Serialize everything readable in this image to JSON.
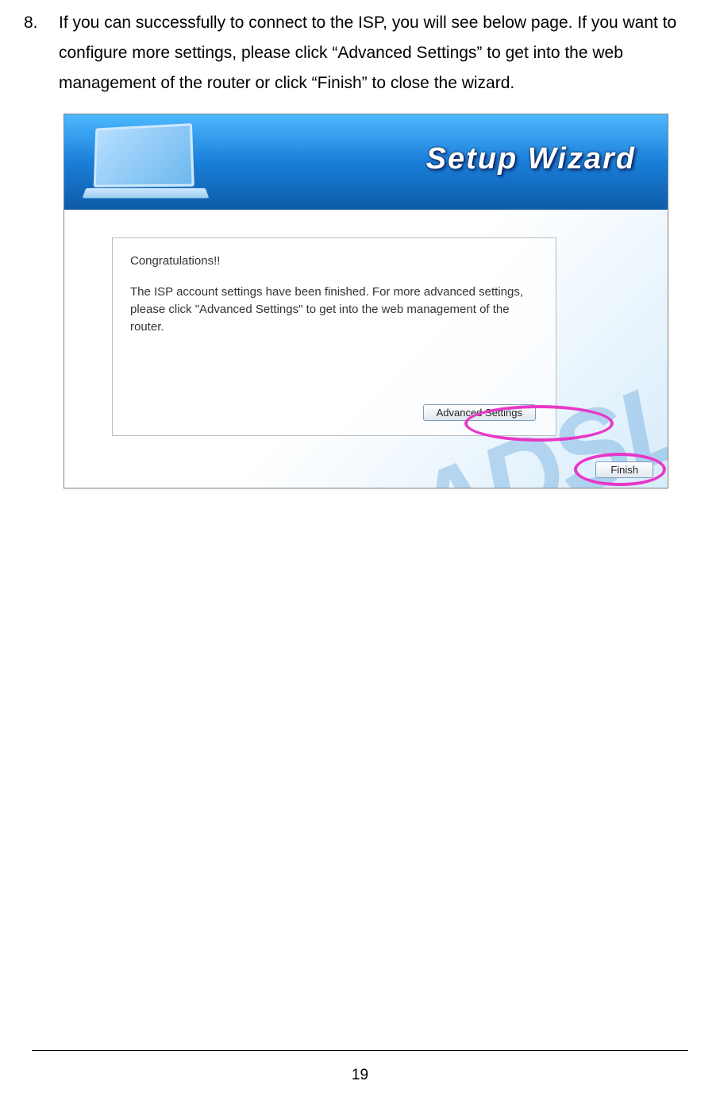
{
  "step": {
    "number": "8.",
    "text": "If you can successfully to connect to the ISP, you will see below page. If you want to configure more settings, please click “Advanced Settings” to get into the web management of the router or click “Finish” to close the wizard."
  },
  "wizard": {
    "title": "Setup Wizard",
    "bg_text": "ADSL",
    "congrats": "Congratulations!!",
    "info": "The ISP account settings have been finished. For more advanced settings, please click \"Advanced Settings\" to get into the web management of the router.",
    "advanced_button": "Advanced Settings",
    "finish_button": "Finish"
  },
  "page_number": "19"
}
